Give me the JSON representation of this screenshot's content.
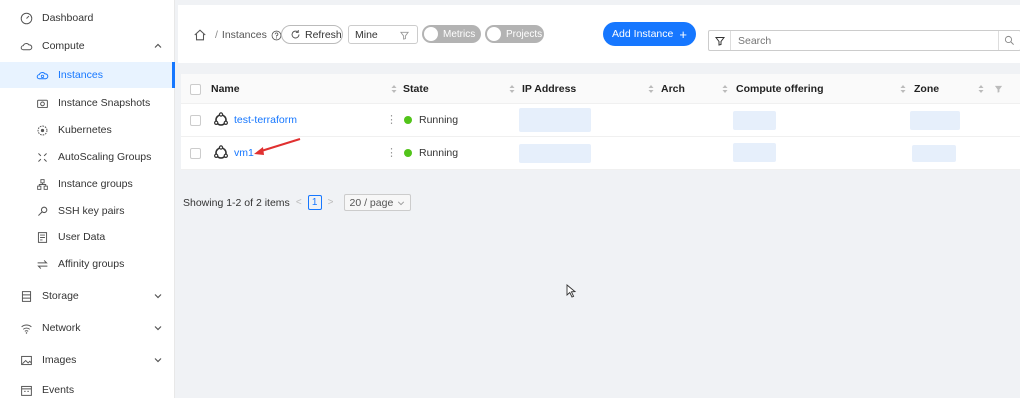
{
  "sidebar": {
    "items": [
      {
        "label": "Dashboard",
        "icon": "dashboard-icon"
      },
      {
        "label": "Compute",
        "icon": "cloud-icon",
        "expanded": true
      },
      {
        "label": "Instances",
        "icon": "cloud-instance-icon",
        "active": true
      },
      {
        "label": "Instance Snapshots",
        "icon": "camera-icon"
      },
      {
        "label": "Kubernetes",
        "icon": "kubernetes-icon"
      },
      {
        "label": "AutoScaling Groups",
        "icon": "autoscaling-icon"
      },
      {
        "label": "Instance groups",
        "icon": "group-icon"
      },
      {
        "label": "SSH key pairs",
        "icon": "key-icon"
      },
      {
        "label": "User Data",
        "icon": "user-data-icon"
      },
      {
        "label": "Affinity groups",
        "icon": "affinity-icon"
      },
      {
        "label": "Storage",
        "icon": "storage-icon"
      },
      {
        "label": "Network",
        "icon": "wifi-icon"
      },
      {
        "label": "Images",
        "icon": "image-icon"
      },
      {
        "label": "Events",
        "icon": "calendar-icon"
      }
    ]
  },
  "breadcrumb": {
    "sep": "/",
    "current": "Instances"
  },
  "toolbar": {
    "refresh_label": "Refresh",
    "filter_select": "Mine",
    "metrics_label": "Metrics",
    "projects_label": "Projects",
    "add_label": "Add Instance",
    "add_plus": "+",
    "search_placeholder": "Search"
  },
  "table": {
    "columns": [
      "Name",
      "State",
      "IP Address",
      "Arch",
      "Compute offering",
      "Zone"
    ],
    "rows": [
      {
        "name": "test-terraform",
        "state": "Running"
      },
      {
        "name": "vm1",
        "state": "Running"
      }
    ]
  },
  "pagination": {
    "summary": "Showing 1-2 of 2 items",
    "prev": "<",
    "next": ">",
    "current_page": "1",
    "page_size": "20 / page"
  },
  "colors": {
    "accent": "#1677ff",
    "running": "#52c41a",
    "annotation": "#e03030"
  }
}
